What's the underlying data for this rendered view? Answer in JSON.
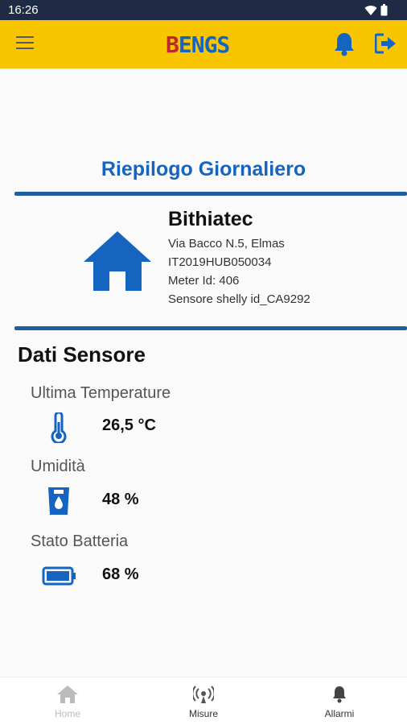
{
  "status_bar": {
    "time": "16:26"
  },
  "app_bar": {
    "logo_first": "B",
    "logo_rest": "ENGS",
    "icons": [
      "menu-icon",
      "bell-icon",
      "logout-icon"
    ]
  },
  "summary": {
    "title": "Riepilogo Giornaliero",
    "company": "Bithiatec",
    "address": "Via Bacco N.5, Elmas",
    "hub_id": "IT2019HUB050034",
    "meter": "Meter Id: 406",
    "sensor": "Sensore shelly id_CA9292"
  },
  "sensor_data": {
    "section_title": "Dati Sensore",
    "temperature_label": "Ultima Temperature",
    "temperature_value": "26,5 °C",
    "humidity_label": "Umidità",
    "humidity_value": "48 %",
    "battery_label": "Stato Batteria",
    "battery_value": "68 %"
  },
  "bottom_nav": {
    "home": "Home",
    "measures": "Misure",
    "alarms": "Allarmi"
  },
  "colors": {
    "app_bar": "#f9c400",
    "accent_blue": "#1565c0",
    "status_bar": "#1f2a44"
  }
}
